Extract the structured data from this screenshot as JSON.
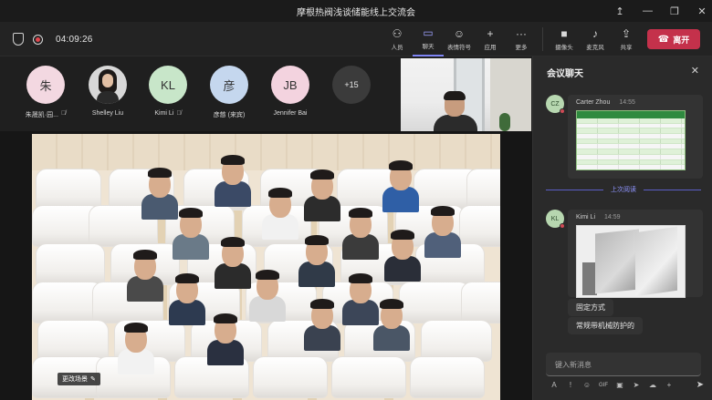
{
  "window": {
    "title": "摩根热阀浅谈储能线上交流会",
    "controls": [
      "↥",
      "—",
      "❐",
      "✕"
    ]
  },
  "toolbar": {
    "timer": "04:09:26",
    "tools": [
      {
        "label": "人员",
        "icon": "people-icon",
        "glyph": "⚇"
      },
      {
        "label": "聊天",
        "icon": "chat-icon",
        "glyph": "💬"
      },
      {
        "label": "表情符号",
        "icon": "emoji-icon",
        "glyph": "☺"
      },
      {
        "label": "应用",
        "icon": "apps-icon",
        "glyph": "+"
      },
      {
        "label": "更多",
        "icon": "more-icon",
        "glyph": "···"
      }
    ],
    "media": [
      {
        "label": "摄像头",
        "icon": "camera-icon",
        "glyph": "■"
      },
      {
        "label": "麦克风",
        "icon": "microphone-icon",
        "glyph": "♪"
      },
      {
        "label": "共享",
        "icon": "share-icon",
        "glyph": "⇪"
      }
    ],
    "leave_label": "离开",
    "leave_color": "#c4314b",
    "active_color": "#7f85f5"
  },
  "participants": [
    {
      "initials": "朱",
      "name": "朱晟凯·园...",
      "color": "#f3d8e1",
      "muted": true
    },
    {
      "initials": "",
      "name": "Shelley Liu",
      "color": "#d8d8d8",
      "muted": false,
      "photo": true
    },
    {
      "initials": "KL",
      "name": "Kimi Li",
      "color": "#c8e6c9",
      "muted": true
    },
    {
      "initials": "彦",
      "name": "彦慈 (来宾)",
      "color": "#c5d7ee",
      "muted": false
    },
    {
      "initials": "JB",
      "name": "Jennifer Bai",
      "color": "#f3d3df",
      "muted": false
    },
    {
      "initials": "+15",
      "name": "",
      "color": "#3b3b3b",
      "muted": false
    }
  ],
  "stage": {
    "change_background_label": "更改场景"
  },
  "chat": {
    "header": "会议聊天",
    "messages": [
      {
        "initials": "CZ",
        "author": "Carter Zhou",
        "time": "14:55",
        "type": "image",
        "image": "table-screenshot"
      },
      {
        "initials": "KL",
        "author": "Kimi Li",
        "time": "14:59",
        "type": "image",
        "image": "panel-photo"
      }
    ],
    "last_read_label": "上次阅读",
    "text_messages": [
      "固定方式",
      "常规带机械防护的"
    ],
    "compose_placeholder": "键入新消息",
    "compose_tools": [
      "A",
      "!",
      "☺",
      "GIF",
      "▣",
      "➤",
      "☁",
      "+"
    ]
  }
}
